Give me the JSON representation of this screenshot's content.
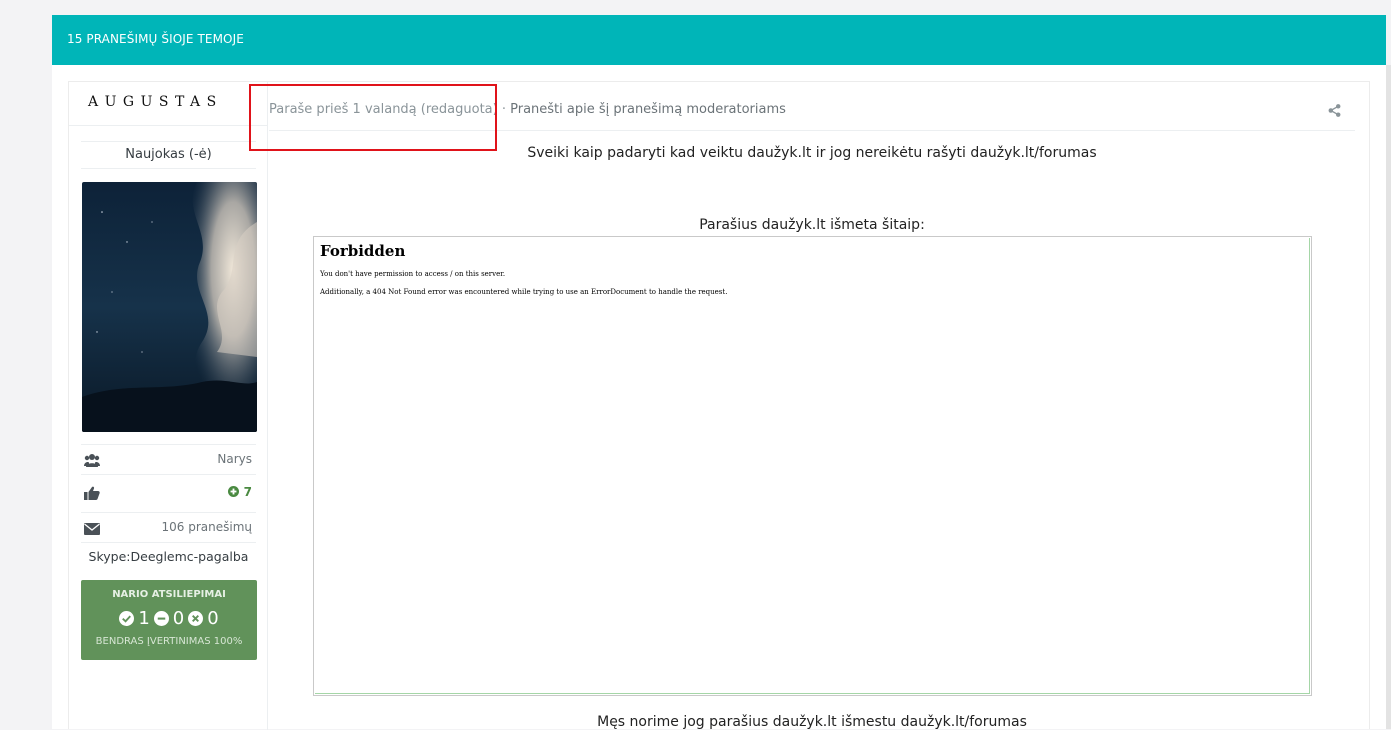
{
  "topbar": {
    "title": "15 PRANEŠIMŲ ŠIOJE TEMOJE"
  },
  "author": {
    "name": "AUGUSTAS",
    "rank": "Naujokas (-ė)",
    "group": "Narys",
    "reputation": "7",
    "posts": "106 pranešimų",
    "custom_field": "Skype:Deeglemc-pagalba",
    "feedback": {
      "title": "NARIO ATSILIEPIMAI",
      "positive": "1",
      "neutral": "0",
      "negative": "0",
      "total": "BENDRAS ĮVERTINIMAS 100%"
    }
  },
  "post": {
    "posted": "Paraše prieš 1 valandą (redaguota)",
    "separator": " · ",
    "report": "Pranešti apie šį pranešimą moderatoriams",
    "p1": "Sveiki kaip padaryti kad veiktu daužyk.lt ir jog nereikėtu rašyti daužyk.lt/forumas",
    "p2": "Parašius daužyk.lt išmeta šitaip:",
    "p3": "Męs norime jog parašius daužyk.lt išmestu daužyk.lt/forumas",
    "screenshot": {
      "heading": "Forbidden",
      "line1": "You don't have permission to access / on this server.",
      "line2": "Additionally, a 404 Not Found error was encountered while trying to use an ErrorDocument to handle the request."
    }
  },
  "icons": [
    "group-icon",
    "thumbs-up-icon",
    "envelope-icon",
    "plus-circle-icon",
    "share-icon",
    "check-circle-icon",
    "minus-circle-icon",
    "times-circle-icon"
  ],
  "colors": {
    "topbar": "#00b5b8",
    "feedback": "#61925a",
    "highlight": "#e0131a"
  }
}
